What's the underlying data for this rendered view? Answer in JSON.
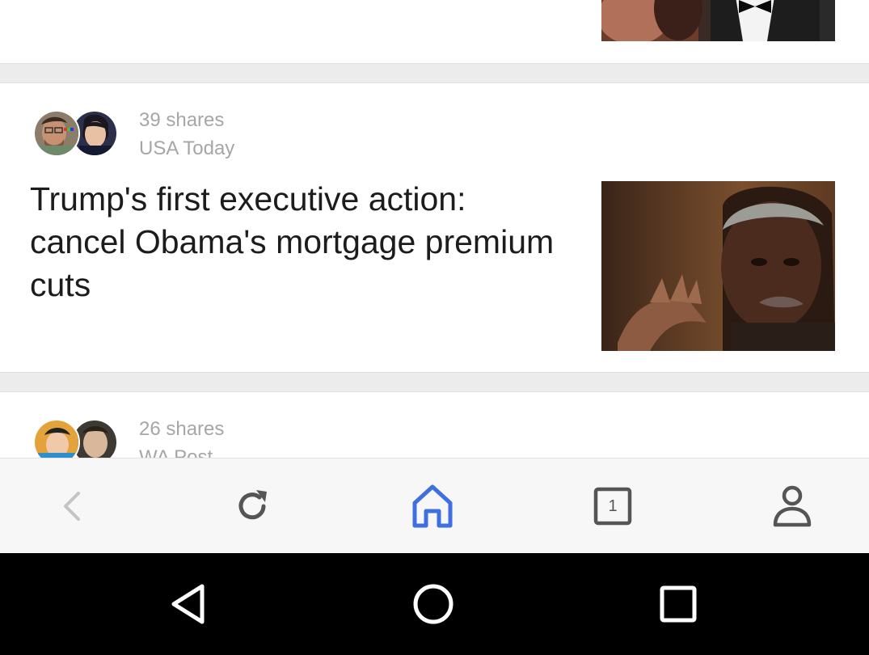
{
  "feed": {
    "stories": [
      {
        "shares": "39 shares",
        "source": "USA Today",
        "headline": "Trump's first executive action: cancel Obama's mortgage premium cuts"
      },
      {
        "shares": "26 shares",
        "source": "WA Post"
      }
    ]
  },
  "toolbar": {
    "tab_count": "1",
    "accent_color": "#3f6fe0",
    "icons": [
      "back-icon",
      "reload-icon",
      "home-icon",
      "tabs-icon",
      "profile-icon"
    ]
  },
  "system_nav": {
    "icons": [
      "nav-back-icon",
      "nav-home-icon",
      "nav-recents-icon"
    ]
  }
}
